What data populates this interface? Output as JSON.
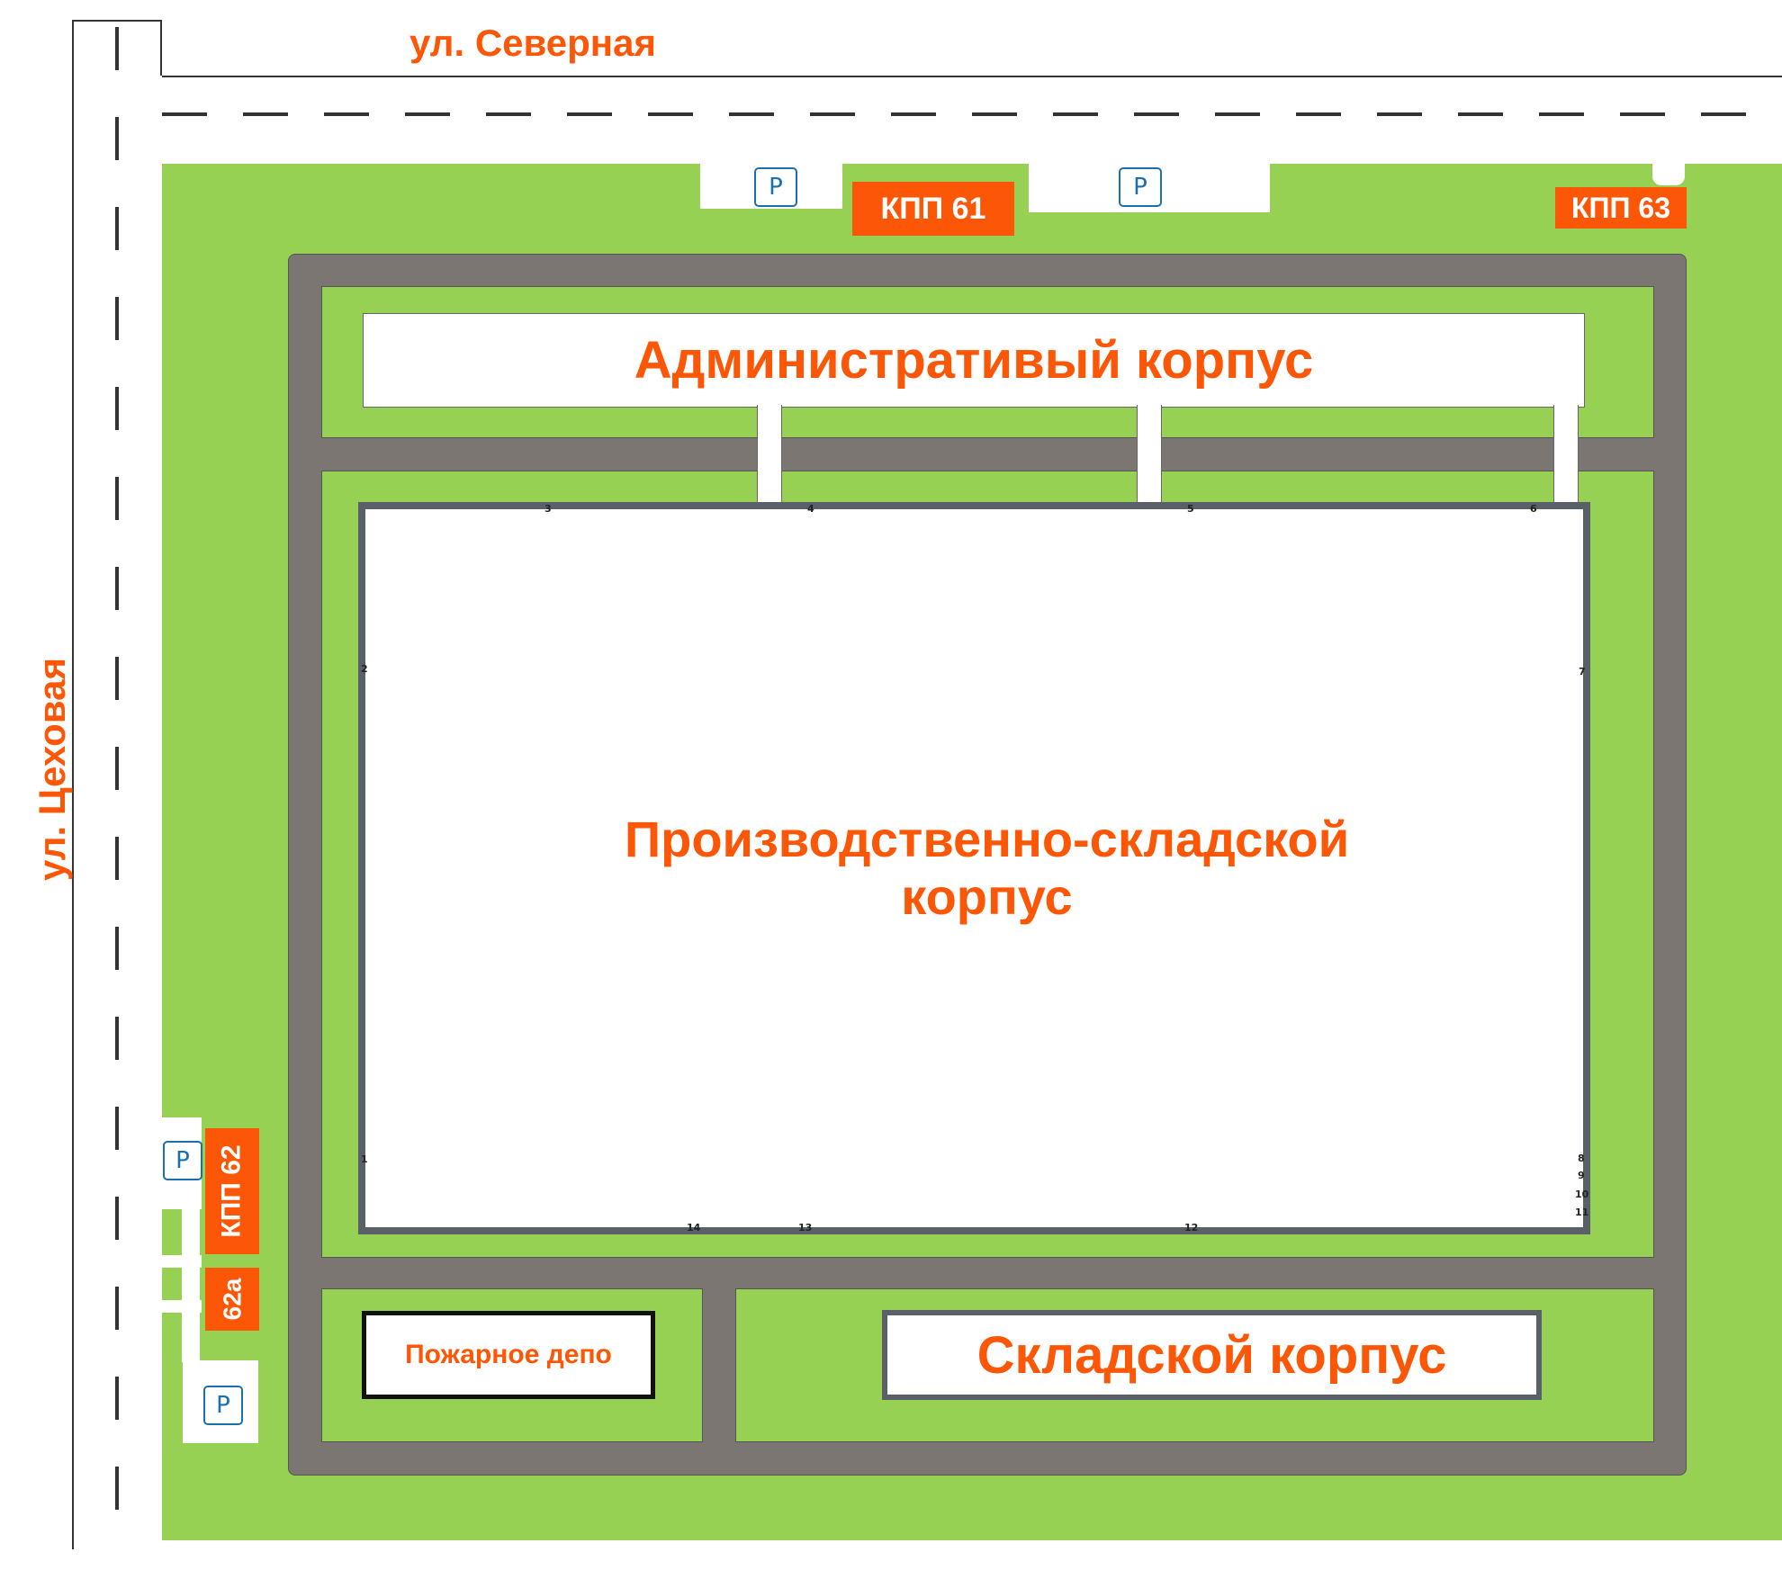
{
  "streets": {
    "north": "ул. Северная",
    "west": "ул. Цеховая"
  },
  "buildings": {
    "admin": "Административый корпус",
    "production_line1": "Производственно-складской",
    "production_line2": "корпус",
    "warehouse": "Складской корпус",
    "fire_depot": "Пожарное депо"
  },
  "checkpoints": {
    "kpp61": "КПП 61",
    "kpp63": "КПП 63",
    "kpp62": "КПП 62",
    "kpp62a": "62а"
  },
  "parking_label": "P",
  "gate_numbers": [
    "3",
    "4",
    "5",
    "6",
    "2",
    "7",
    "1",
    "8",
    "9",
    "10",
    "11",
    "12",
    "13",
    "14"
  ],
  "colors": {
    "accent": "#fc5607",
    "lawn": "#97d153",
    "driveway": "#7b7672",
    "building_border": "#5a6068",
    "parking": "#1a6fb0"
  }
}
